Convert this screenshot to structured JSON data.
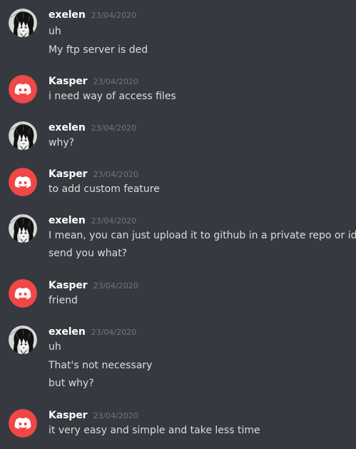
{
  "messages": [
    {
      "author": "exelen",
      "avatar": "anime-avatar",
      "timestamp": "23/04/2020",
      "lines": [
        "uh",
        "My ftp server is ded"
      ]
    },
    {
      "author": "Kasper",
      "avatar": "discord-logo-avatar",
      "timestamp": "23/04/2020",
      "lines": [
        "i need way of access files"
      ]
    },
    {
      "author": "exelen",
      "avatar": "anime-avatar",
      "timestamp": "23/04/2020",
      "lines": [
        "why?"
      ]
    },
    {
      "author": "Kasper",
      "avatar": "discord-logo-avatar",
      "timestamp": "23/04/2020",
      "lines": [
        "to add custom feature"
      ]
    },
    {
      "author": "exelen",
      "avatar": "anime-avatar",
      "timestamp": "23/04/2020",
      "lines": [
        "I mean, you can just upload it to github in a private repo or idk",
        "send you what?"
      ]
    },
    {
      "author": "Kasper",
      "avatar": "discord-logo-avatar",
      "timestamp": "23/04/2020",
      "lines": [
        "friend"
      ]
    },
    {
      "author": "exelen",
      "avatar": "anime-avatar",
      "timestamp": "23/04/2020",
      "lines": [
        "uh",
        "That's not necessary",
        "but why?"
      ]
    },
    {
      "author": "Kasper",
      "avatar": "discord-logo-avatar",
      "timestamp": "23/04/2020",
      "lines": [
        "it very easy and simple and take less time"
      ]
    }
  ],
  "colors": {
    "background": "#36393f",
    "username": "#ffffff",
    "timestamp": "#72767d",
    "message_text": "#dcddde",
    "discord_avatar_bg": "#f04747"
  }
}
